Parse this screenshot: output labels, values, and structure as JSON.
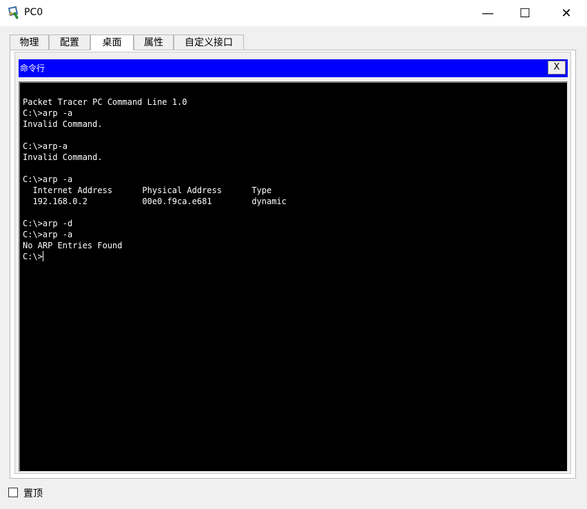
{
  "window": {
    "title": "PC0",
    "icon": "packet-tracer-pc-icon",
    "min_glyph": "—",
    "max_glyph": "☐",
    "close_glyph": "✕"
  },
  "tabs": [
    {
      "label": "物理",
      "active": false
    },
    {
      "label": "配置",
      "active": false
    },
    {
      "label": "桌面",
      "active": true
    },
    {
      "label": "属性",
      "active": false
    },
    {
      "label": "自定义接口",
      "active": false
    }
  ],
  "command_line": {
    "title": "命令行",
    "close_label": "X",
    "output": "Packet Tracer PC Command Line 1.0\nC:\\>arp -a\nInvalid Command.\n\nC:\\>arp-a\nInvalid Command.\n\nC:\\>arp -a\n  Internet Address      Physical Address      Type\n  192.168.0.2           00e0.f9ca.e681        dynamic\n\nC:\\>arp -d\nC:\\>arp -a\nNo ARP Entries Found\n",
    "prompt": "C:\\>"
  },
  "footer": {
    "topmost_label": "置顶",
    "topmost_checked": false
  },
  "colors": {
    "header_blue": "#0000ff",
    "terminal_bg": "#000000",
    "terminal_fg": "#ffffff"
  }
}
